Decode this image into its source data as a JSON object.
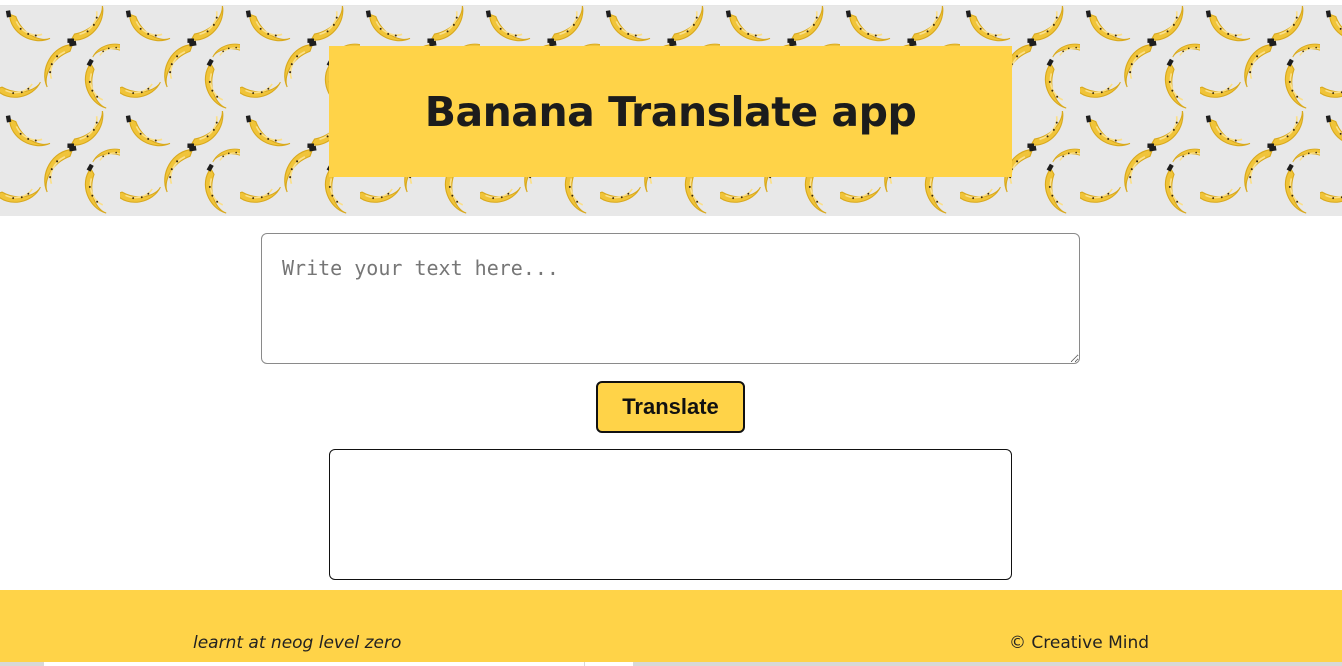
{
  "header": {
    "title": "Banana Translate app"
  },
  "input": {
    "placeholder": "Write your text here...",
    "value": ""
  },
  "actions": {
    "translate_label": "Translate"
  },
  "output": {
    "text": ""
  },
  "footer": {
    "left_text": "learnt at neog level zero",
    "right_text": "© Creative Mind"
  },
  "theme": {
    "accent": "#ffd348",
    "pattern_background": "#e8e8e8",
    "banana_color": "#f0c43a",
    "text_color": "#1c1c1c"
  },
  "icons": {
    "background_pattern": "banana-icon"
  }
}
